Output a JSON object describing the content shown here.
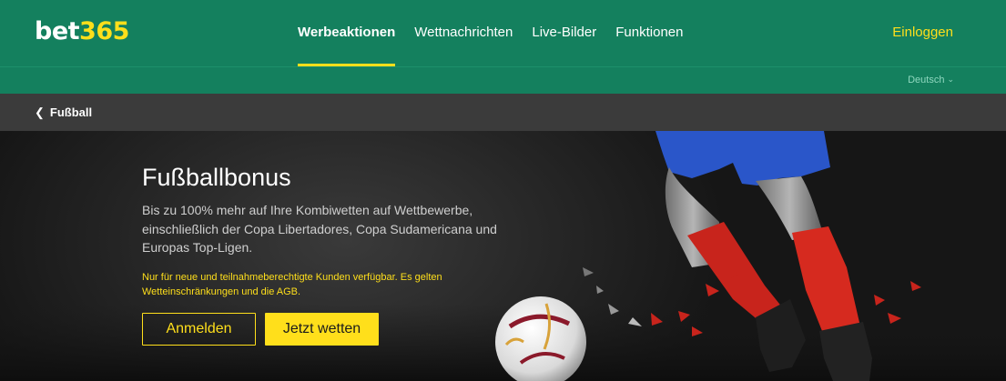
{
  "brand": {
    "logo_left": "bet",
    "logo_right": "365"
  },
  "nav": {
    "items": [
      {
        "label": "Werbeaktionen",
        "active": true
      },
      {
        "label": "Wettnachrichten",
        "active": false
      },
      {
        "label": "Live-Bilder",
        "active": false
      },
      {
        "label": "Funktionen",
        "active": false
      }
    ],
    "login_label": "Einloggen"
  },
  "language": {
    "selected": "Deutsch",
    "icon": "chevron-down-icon"
  },
  "breadcrumb": {
    "back_label": "Fußball",
    "icon": "chevron-left-icon"
  },
  "hero": {
    "title": "Fußballbonus",
    "description": "Bis zu 100% mehr auf Ihre Kombiwetten auf Wettbewerbe, einschließlich der Copa Libertadores, Copa Sudamericana und Europas Top-Ligen.",
    "disclaimer": "Nur für neue und teilnahmeberechtigte Kunden verfügbar. Es gelten Wetteinschränkungen und die AGB.",
    "join_label": "Anmelden",
    "bet_label": "Jetzt wetten"
  },
  "colors": {
    "brand_green": "#14805e",
    "accent_yellow": "#ffdf1b",
    "dark_bar": "#3b3b3b"
  }
}
